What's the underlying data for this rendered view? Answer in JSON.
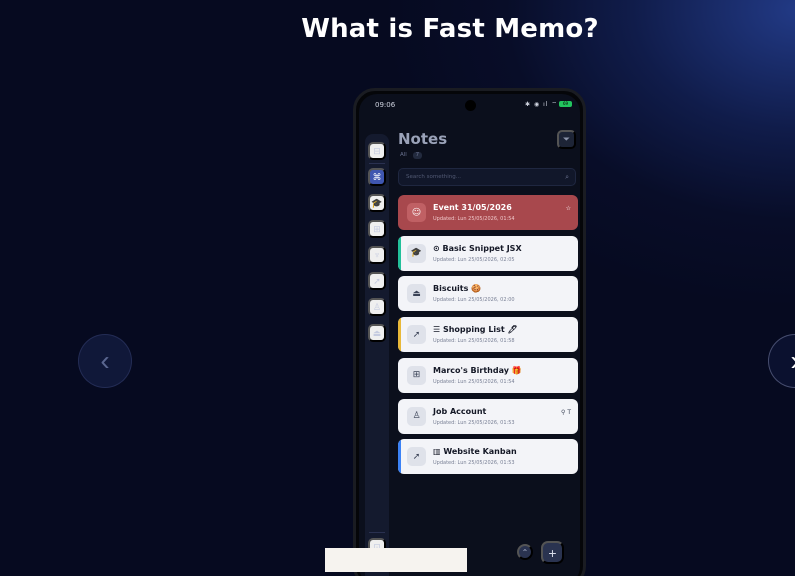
{
  "page": {
    "headline": "What is Fast Memo?"
  },
  "carousel": {
    "prev_icon": "‹",
    "next_icon": "›"
  },
  "phone": {
    "status": {
      "time": "09:06",
      "icons": "✱ ◉ ıl ⌔",
      "battery": "69"
    },
    "header": {
      "title": "Notes",
      "filter_all": "All",
      "filter_count": "7"
    },
    "search": {
      "placeholder": "Search something...",
      "icon": "⌕"
    },
    "rail": [
      {
        "name": "layout-icon",
        "glyph": "⊟"
      },
      {
        "name": "grid-icon",
        "glyph": "⌘",
        "active": true
      },
      {
        "name": "graduation-cap-icon",
        "glyph": "🎓"
      },
      {
        "name": "gift-icon",
        "glyph": "⊞"
      },
      {
        "name": "trophy-icon",
        "glyph": "♆"
      },
      {
        "name": "rocket-icon",
        "glyph": "➚"
      },
      {
        "name": "user-icon",
        "glyph": "♙"
      },
      {
        "name": "cake-icon",
        "glyph": "⏏"
      }
    ],
    "rail_bottom_icon": "⊡",
    "notes": [
      {
        "icon": "☺",
        "icon_name": "smile-icon",
        "title": "Event 31/05/2026",
        "updated": "Updated: Lun 25/05/2026, 01:54",
        "right": "☆",
        "style": "red",
        "accent": ""
      },
      {
        "icon": "🎓",
        "icon_name": "graduation-cap-icon",
        "title": "⊙ Basic Snippet JSX",
        "updated": "Updated: Lun 25/05/2026, 02:05",
        "right": "",
        "style": "",
        "accent": "#22c09a"
      },
      {
        "icon": "⏏",
        "icon_name": "cake-icon",
        "title": "Biscuits 🍪",
        "updated": "Updated: Lun 25/05/2026, 02:00",
        "right": "",
        "style": "",
        "accent": ""
      },
      {
        "icon": "➚",
        "icon_name": "rocket-icon",
        "title": "☰ Shopping List 🖊",
        "updated": "Updated: Lun 25/05/2026, 01:58",
        "right": "",
        "style": "",
        "accent": "#e8b838"
      },
      {
        "icon": "⊞",
        "icon_name": "gift-icon",
        "title": "Marco's Birthday 🎁",
        "updated": "Updated: Lun 25/05/2026, 01:54",
        "right": "",
        "style": "",
        "accent": ""
      },
      {
        "icon": "♙",
        "icon_name": "user-icon",
        "title": "Job Account",
        "updated": "Updated: Lun 25/05/2026, 01:53",
        "right": "⚲ T",
        "style": "",
        "accent": ""
      },
      {
        "icon": "➚",
        "icon_name": "rocket-icon",
        "title": "▥ Website Kanban",
        "updated": "Updated: Lun 25/05/2026, 01:53",
        "right": "",
        "style": "",
        "accent": "#3b82f6"
      }
    ],
    "fab_up": "⌃",
    "fab_add": "+"
  }
}
